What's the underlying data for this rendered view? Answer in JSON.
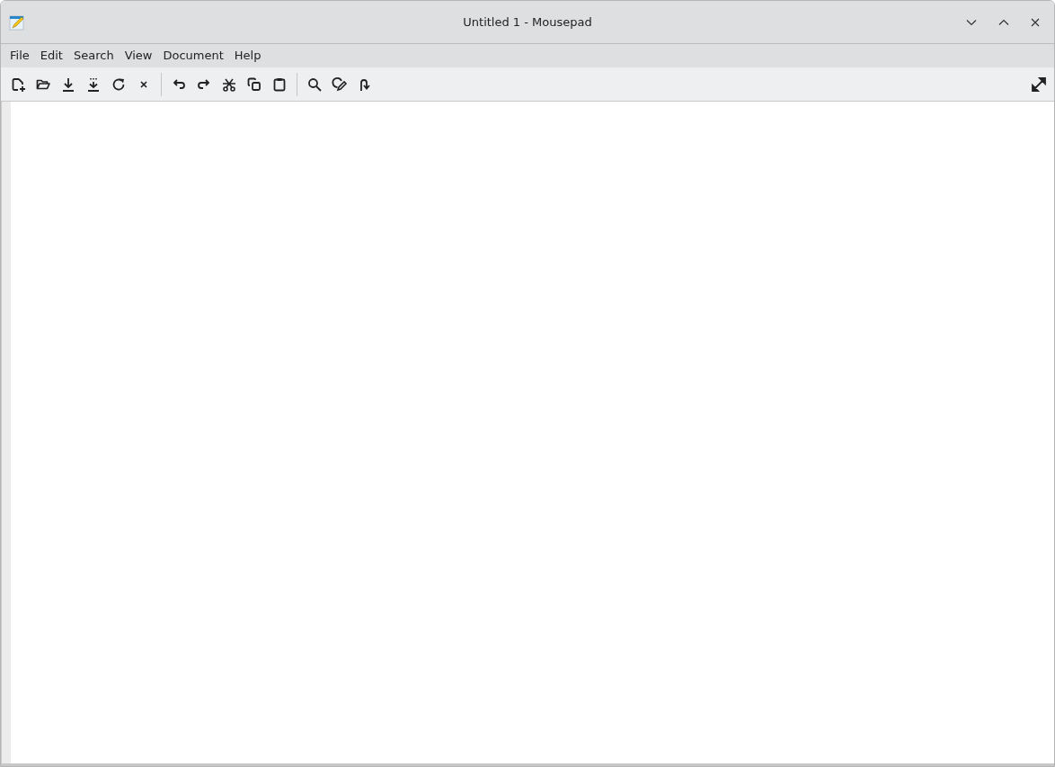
{
  "window": {
    "title": "Untitled 1 - Mousepad"
  },
  "menu": [
    "File",
    "Edit",
    "Search",
    "View",
    "Document",
    "Help"
  ]
}
